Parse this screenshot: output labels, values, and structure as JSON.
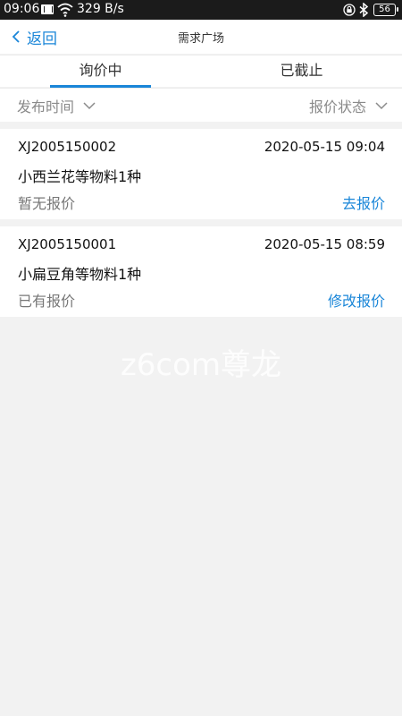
{
  "status_bar": {
    "time": "09:06",
    "speed": "329 B/s",
    "battery": "56"
  },
  "nav": {
    "back_label": "返回",
    "title": "需求广场"
  },
  "tabs": [
    {
      "label": "询价中",
      "active": true
    },
    {
      "label": "已截止",
      "active": false
    }
  ],
  "filters": {
    "left": "发布时间",
    "right": "报价状态"
  },
  "inquiries": [
    {
      "code": "XJ2005150002",
      "datetime": "2020-05-15 09:04",
      "name": "小西兰花等物料1种",
      "status": "暂无报价",
      "action": "去报价"
    },
    {
      "code": "XJ2005150001",
      "datetime": "2020-05-15 08:59",
      "name": "小扁豆角等物料1种",
      "status": "已有报价",
      "action": "修改报价"
    }
  ],
  "watermark": "z6com尊龙",
  "colors": {
    "accent": "#1a86d8",
    "status_bar_bg": "#1b1b1b",
    "page_bg": "#f2f2f2"
  },
  "icons": [
    "mail-icon",
    "wifi-icon",
    "lock-icon",
    "bluetooth-icon",
    "battery-icon",
    "chevron-left-icon",
    "chevron-down-icon"
  ]
}
